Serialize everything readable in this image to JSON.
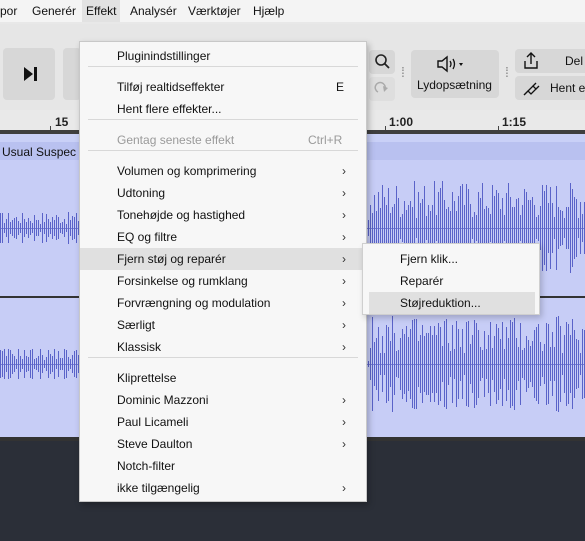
{
  "menubar": {
    "items": [
      "por",
      "Generér",
      "Effekt",
      "Analysér",
      "Værktøjer",
      "Hjælp"
    ]
  },
  "toolbar": {
    "audio_setup_label": "Lydopsætning",
    "share_label": "Del",
    "plugin_label": "Hent e"
  },
  "ruler": {
    "labels": [
      "15",
      "1:00",
      "1:15"
    ]
  },
  "track": {
    "title": "Usual Suspec"
  },
  "effect_menu": {
    "items": [
      {
        "label": "Pluginindstillinger",
        "shortcut": "",
        "submenu": false,
        "disabled": false
      },
      {
        "label": "Tilføj realtidseffekter",
        "shortcut": "E",
        "submenu": false,
        "disabled": false
      },
      {
        "label": "Hent flere effekter...",
        "shortcut": "",
        "submenu": false,
        "disabled": false
      },
      {
        "label": "Gentag seneste effekt",
        "shortcut": "Ctrl+R",
        "submenu": false,
        "disabled": true
      },
      {
        "label": "Volumen og komprimering",
        "shortcut": "",
        "submenu": true,
        "disabled": false
      },
      {
        "label": "Udtoning",
        "shortcut": "",
        "submenu": true,
        "disabled": false
      },
      {
        "label": "Tonehøjde og hastighed",
        "shortcut": "",
        "submenu": true,
        "disabled": false
      },
      {
        "label": "EQ og filtre",
        "shortcut": "",
        "submenu": true,
        "disabled": false
      },
      {
        "label": "Fjern støj og reparér",
        "shortcut": "",
        "submenu": true,
        "disabled": false,
        "highlighted": true
      },
      {
        "label": "Forsinkelse og rumklang",
        "shortcut": "",
        "submenu": true,
        "disabled": false
      },
      {
        "label": "Forvrængning og modulation",
        "shortcut": "",
        "submenu": true,
        "disabled": false
      },
      {
        "label": "Særligt",
        "shortcut": "",
        "submenu": true,
        "disabled": false
      },
      {
        "label": "Klassisk",
        "shortcut": "",
        "submenu": true,
        "disabled": false
      },
      {
        "label": "Kliprettelse",
        "shortcut": "",
        "submenu": false,
        "disabled": false
      },
      {
        "label": "Dominic Mazzoni",
        "shortcut": "",
        "submenu": true,
        "disabled": false
      },
      {
        "label": "Paul Licameli",
        "shortcut": "",
        "submenu": true,
        "disabled": false
      },
      {
        "label": "Steve Daulton",
        "shortcut": "",
        "submenu": true,
        "disabled": false
      },
      {
        "label": "Notch-filter",
        "shortcut": "",
        "submenu": false,
        "disabled": false
      },
      {
        "label": "ikke tilgængelig",
        "shortcut": "",
        "submenu": true,
        "disabled": false
      }
    ]
  },
  "noise_submenu": {
    "items": [
      {
        "label": "Fjern klik..."
      },
      {
        "label": "Reparér"
      },
      {
        "label": "Støjreduktion...",
        "highlighted": true
      }
    ]
  },
  "icons": {
    "skip_end": "skip-to-end-icon",
    "zoom": "magnifier-icon",
    "redo": "redo-icon",
    "speaker": "speaker-icon",
    "share": "share-icon",
    "plugin": "plug-icon"
  },
  "colors": {
    "waveform": "#5a63c9",
    "track_bg": "#c7cdf6",
    "menu_highlight": "#e0e0e0"
  }
}
